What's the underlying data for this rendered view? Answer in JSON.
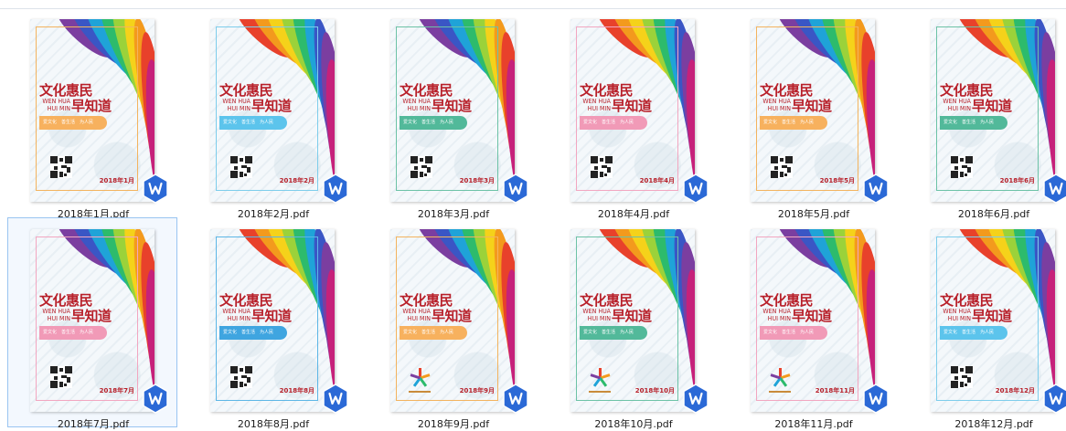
{
  "files": [
    {
      "name": "2018年1月.pdf",
      "date": "2018年1月",
      "accent": "#f7b15e",
      "frame": "#f3b35e",
      "footer": "qr"
    },
    {
      "name": "2018年2月.pdf",
      "date": "2018年2月",
      "accent": "#5cc4ec",
      "frame": "#7dcdeb",
      "footer": "qr"
    },
    {
      "name": "2018年3月.pdf",
      "date": "2018年3月",
      "accent": "#52b99a",
      "frame": "#6cc2a6",
      "footer": "qr"
    },
    {
      "name": "2018年4月.pdf",
      "date": "2018年4月",
      "accent": "#f19ab7",
      "frame": "#f2a6c0",
      "footer": "qr"
    },
    {
      "name": "2018年5月.pdf",
      "date": "2018年5月",
      "accent": "#f7b15e",
      "frame": "#f3b35e",
      "footer": "qr"
    },
    {
      "name": "2018年6月.pdf",
      "date": "2018年6月",
      "accent": "#52b99a",
      "frame": "#6cc2a6",
      "footer": "qr"
    },
    {
      "name": "2018年7月.pdf",
      "date": "2018年7月",
      "accent": "#f19ab7",
      "frame": "#f2a6c0",
      "footer": "qr"
    },
    {
      "name": "2018年8月.pdf",
      "date": "2018年8月",
      "accent": "#3fa5e0",
      "frame": "#5cb6e6",
      "footer": "qr"
    },
    {
      "name": "2018年9月.pdf",
      "date": "2018年9月",
      "accent": "#f7b15e",
      "frame": "#f3b35e",
      "footer": "logo"
    },
    {
      "name": "2018年10月.pdf",
      "date": "2018年10月",
      "accent": "#52b99a",
      "frame": "#6cc2a6",
      "footer": "logo"
    },
    {
      "name": "2018年11月.pdf",
      "date": "2018年11月",
      "accent": "#f19ab7",
      "frame": "#f2a6c0",
      "footer": "logo"
    },
    {
      "name": "2018年12月.pdf",
      "date": "2018年12月",
      "accent": "#5cc4ec",
      "frame": "#7dcdeb",
      "footer": "qr"
    }
  ],
  "poster": {
    "title_cn_1": "文化惠民",
    "title_en": "WEN HUA HUI MIN",
    "title_cn_2": "早知道",
    "banner": "爱文化　善生活　为人民"
  },
  "selected_index": 6,
  "badge_icon": "wps-pdf-icon"
}
